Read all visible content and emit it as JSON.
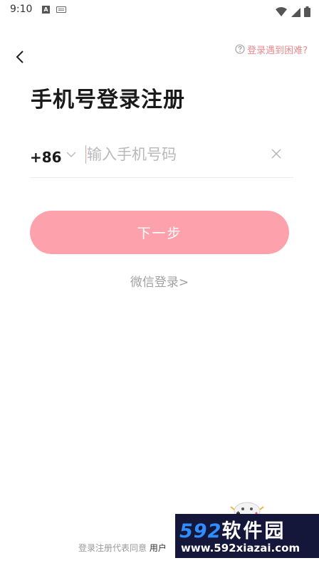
{
  "status_bar": {
    "time": "9:10",
    "icons": [
      "a-notification-icon",
      "keyboard-icon",
      "wifi-icon",
      "signal-icon",
      "battery-icon"
    ]
  },
  "header": {
    "back_icon": "chevron-left-icon",
    "help_icon": "question-circle-icon",
    "help_label": "登录遇到困难?"
  },
  "title": "手机号登录注册",
  "phone": {
    "country_code": "+86",
    "chevron_icon": "chevron-down-icon",
    "placeholder": "输入手机号码",
    "value": "",
    "clear_icon": "close-icon"
  },
  "next_label": "下一步",
  "wechat_login_label": "微信登录>",
  "agreement": {
    "prefix": "登录注册代表同意",
    "link_partial": "用户"
  },
  "watermark": {
    "brand_num": "592",
    "brand_cn": "软件园",
    "url": "www.592xiazai.com"
  },
  "colors": {
    "accent": "#fda2ad",
    "help_text": "#e98b91",
    "background": "#ffffff"
  }
}
